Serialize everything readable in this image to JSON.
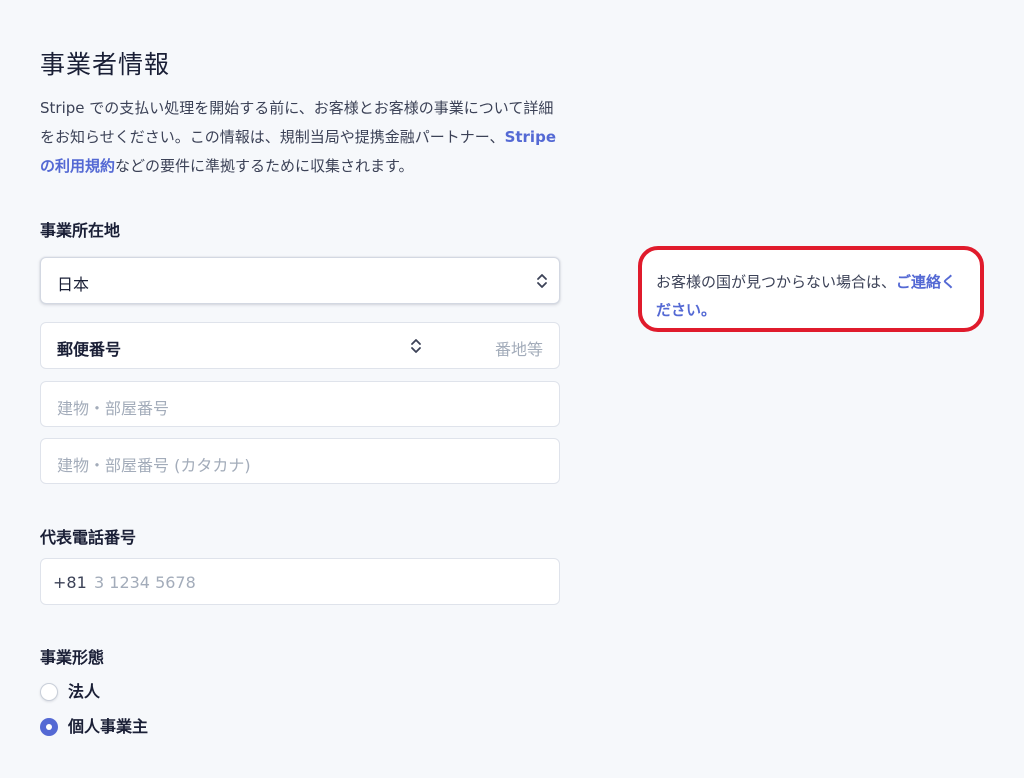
{
  "header": {
    "title": "事業者情報",
    "intro_text": "Stripe での支払い処理を開始する前に、お客様とお客様の事業について詳細をお知らせください。この情報は、規制当局や提携金融パートナー、",
    "intro_link": "Stripe の利用規約",
    "intro_text_after": "などの要件に準拠するために収集されます。"
  },
  "address": {
    "label": "事業所在地",
    "country_value": "日本",
    "postal_value": "郵便番号",
    "street_placeholder": "番地等",
    "building_placeholder": "建物・部屋番号",
    "building_kana_placeholder": "建物・部屋番号 (カタカナ)"
  },
  "phone": {
    "label": "代表電話番号",
    "country_code": "+81",
    "placeholder": "3 1234 5678"
  },
  "business_type": {
    "label": "事業形態",
    "options": [
      {
        "label": "法人",
        "selected": false
      },
      {
        "label": "個人事業主",
        "selected": true
      }
    ]
  },
  "help_note": {
    "text": "お客様の国が見つからない場合は、",
    "link": "ご連絡ください。"
  },
  "icons": {
    "select_arrows": "chevron-up-down-icon"
  },
  "colors": {
    "accent": "#5469d4",
    "highlight_border": "#e01b2c",
    "background": "#f6f8fb"
  }
}
